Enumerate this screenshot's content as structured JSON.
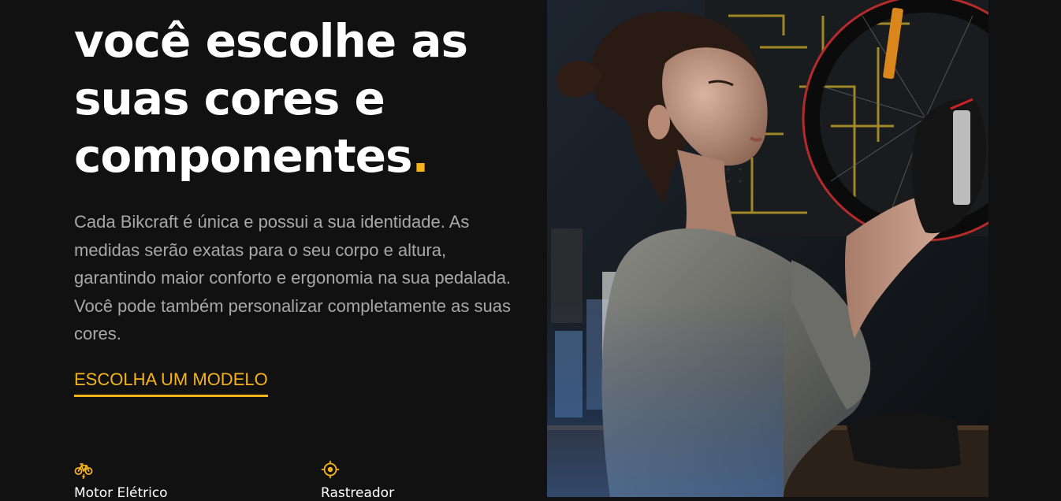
{
  "hero": {
    "headline": {
      "line1": "você escolhe as",
      "line2": "suas cores e",
      "line3": "componentes",
      "accent_dot": "."
    },
    "paragraph": "Cada Bikcraft é única e possui a sua identidade. As medidas serão exatas para o seu corpo e altura, garantindo maior conforto e ergonomia na sua pedalada. Você pode também personalizar completamente as suas cores.",
    "cta_label": "ESCOLHA UM MODELO"
  },
  "features": [
    {
      "icon": "electric-bike-icon",
      "label": "Motor Elétrico"
    },
    {
      "icon": "tracker-icon",
      "label": "Rastreador"
    }
  ],
  "photo": {
    "subject": "woman-repairing-bicycle-photo"
  },
  "colors": {
    "background": "#111111",
    "accent": "#f5b31b",
    "heading": "#ffffff",
    "body_text": "#a8a8a8"
  }
}
